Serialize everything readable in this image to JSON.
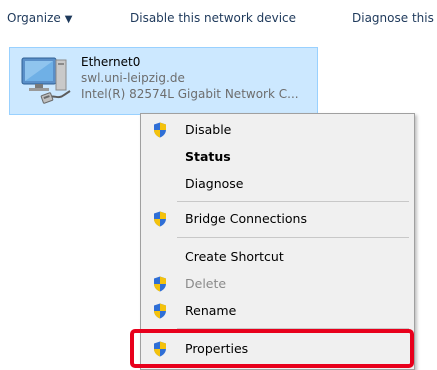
{
  "toolbar": {
    "organize_label": "Organize",
    "disable_label": "Disable this network device",
    "diagnose_label": "Diagnose this"
  },
  "adapter": {
    "name": "Ethernet0",
    "domain": "swl.uni-leipzig.de",
    "device": "Intel(R) 82574L Gigabit Network C...",
    "icon": "network-adapter-icon"
  },
  "context_menu": {
    "items": [
      {
        "label": "Disable",
        "icon": "shield-icon",
        "bold": false,
        "disabled": false
      },
      {
        "label": "Status",
        "icon": null,
        "bold": true,
        "disabled": false
      },
      {
        "label": "Diagnose",
        "icon": null,
        "bold": false,
        "disabled": false
      },
      {
        "label": "Bridge Connections",
        "icon": "shield-icon",
        "bold": false,
        "disabled": false
      },
      {
        "label": "Create Shortcut",
        "icon": null,
        "bold": false,
        "disabled": false
      },
      {
        "label": "Delete",
        "icon": "shield-icon",
        "bold": false,
        "disabled": true
      },
      {
        "label": "Rename",
        "icon": "shield-icon",
        "bold": false,
        "disabled": false
      },
      {
        "label": "Properties",
        "icon": "shield-icon",
        "bold": false,
        "disabled": false
      }
    ]
  },
  "colors": {
    "selection_bg": "#cce8ff",
    "selection_border": "#99d1ff",
    "menu_bg": "#f0f0f0",
    "highlight_border": "#e8001c",
    "toolbar_text": "#1e395b"
  }
}
